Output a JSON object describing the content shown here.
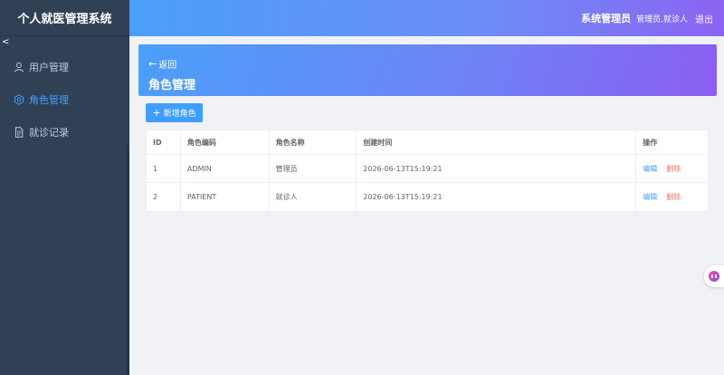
{
  "app": {
    "title": "个人就医管理系统"
  },
  "header": {
    "system_name": "系统管理员",
    "user_roles": "管理员,就诊人",
    "logout_label": "退出"
  },
  "sidebar": {
    "collapse_glyph": "<",
    "items": [
      {
        "label": "用户管理",
        "icon": "user-icon",
        "active": false
      },
      {
        "label": "角色管理",
        "icon": "gear-icon",
        "active": true
      },
      {
        "label": "就诊记录",
        "icon": "document-icon",
        "active": false
      }
    ]
  },
  "page": {
    "back_label": "返回",
    "back_arrow": "←",
    "title": "角色管理",
    "add_button_label": "新增角色",
    "add_button_glyph": "+"
  },
  "table": {
    "columns": [
      "ID",
      "角色编码",
      "角色名称",
      "创建时间",
      "操作"
    ],
    "rows": [
      {
        "id": "1",
        "code": "ADMIN",
        "name": "管理员",
        "created": "2026-06-13T15:19:21",
        "edit": "编辑",
        "delete": "删除"
      },
      {
        "id": "2",
        "code": "PATIENT",
        "name": "就诊人",
        "created": "2026-06-13T15:19:21",
        "edit": "编辑",
        "delete": "删除"
      }
    ]
  },
  "colors": {
    "sidebar_bg": "#304156",
    "accent": "#409eff",
    "danger": "#f56c6c",
    "header_gradient_start": "#4a9ff9",
    "header_gradient_end": "#8b64f3"
  }
}
